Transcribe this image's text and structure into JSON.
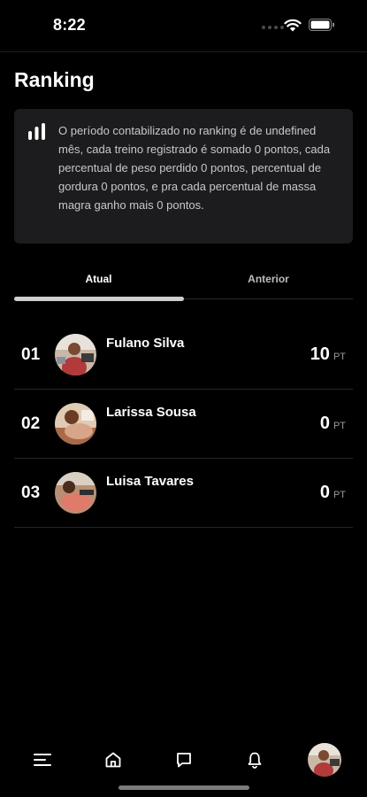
{
  "status_bar": {
    "time": "8:22"
  },
  "header": {
    "title": "Ranking"
  },
  "info_card": {
    "icon": "bar-chart-icon",
    "text": "O período contabilizado no ranking é de undefined mês, cada treino registrado é somado 0 pontos, cada percentual de peso perdido 0 pontos, percentual de gordura 0 pontos, e pra cada percentual de massa magra ganho mais 0 pontos."
  },
  "tabs": [
    {
      "label": "Atual",
      "active": true
    },
    {
      "label": "Anterior",
      "active": false
    }
  ],
  "ranking": [
    {
      "position": "01",
      "name": "Fulano Silva",
      "points": "10",
      "unit": "PT"
    },
    {
      "position": "02",
      "name": "Larissa Sousa",
      "points": "0",
      "unit": "PT"
    },
    {
      "position": "03",
      "name": "Luisa Tavares",
      "points": "0",
      "unit": "PT"
    }
  ],
  "bottom_nav": {
    "items": [
      "menu-icon",
      "home-icon",
      "chat-icon",
      "bell-icon",
      "profile-avatar"
    ]
  },
  "colors": {
    "background": "#000000",
    "card": "#1c1c1e",
    "tab_indicator": "#cfcfcf"
  }
}
